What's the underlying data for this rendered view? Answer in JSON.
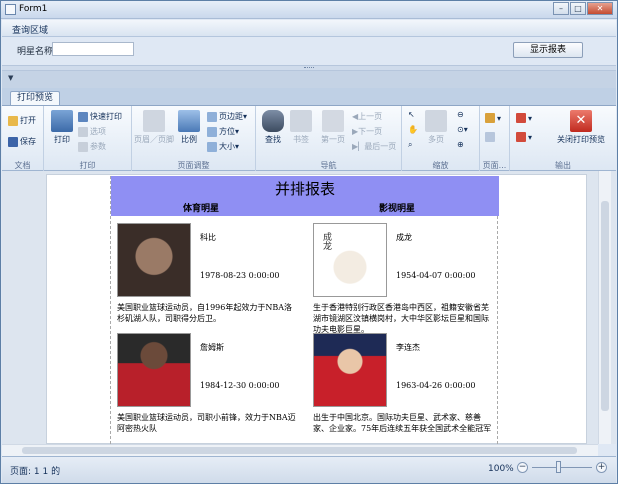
{
  "window": {
    "title": "Form1",
    "min_icon": "minimize-icon",
    "max_icon": "maximize-icon",
    "close_icon": "close-icon"
  },
  "query": {
    "header": "查询区域",
    "star_label": "明星名称",
    "star_value": "",
    "show_button": "显示报表"
  },
  "qat_icon": "dropdown-icon",
  "tab": {
    "label": "打印预览"
  },
  "ribbon": {
    "doc": {
      "label": "文档",
      "open": "打开",
      "save": "保存"
    },
    "print": {
      "label": "打印",
      "print": "打印",
      "quick_print": "快速打印",
      "options": "选项",
      "params": "参数"
    },
    "page_setup": {
      "label": "页面调整",
      "header_footer": "页眉／页脚",
      "scale": "比例",
      "margins": "页边距",
      "orientation": "方位",
      "size": "大小"
    },
    "nav": {
      "label": "导航",
      "find": "查找",
      "bookmarks": "书签",
      "first": "第一页",
      "prev": "上一页",
      "next": "下一页",
      "last": "最后一页"
    },
    "zoom": {
      "label": "缩放",
      "many_pages": "多页"
    },
    "page_bg": {
      "label": "页面..."
    },
    "export": {
      "label": "输出",
      "close": "关闭打印预览"
    }
  },
  "report": {
    "title": "并排报表",
    "col_left": "体育明星",
    "col_right": "影视明星",
    "left": [
      {
        "name": "科比",
        "date": "1978-08-23 0:00:00",
        "desc": "美国职业篮球运动员，自1996年起效力于NBA洛杉矶湖人队，司职得分后卫。"
      },
      {
        "name": "詹姆斯",
        "date": "1984-12-30 0:00:00",
        "desc": "美国职业篮球运动员，司职小前锋，效力于NBA迈阿密热火队"
      }
    ],
    "right": [
      {
        "name": "成龙",
        "date": "1954-04-07 0:00:00",
        "desc": "生于香港特别行政区香港岛中西区，祖籍安徽省芜湖市镜湖区汶镇横岗村，大中华区影坛巨星和国际功夫电影巨星。"
      },
      {
        "name": "李连杰",
        "date": "1963-04-26 0:00:00",
        "desc": "出生于中国北京。国际功夫巨星、武术家、慈善家、企业家。75年后连续五年获全国武术全能冠军"
      }
    ],
    "photo_text_jc": "成龙"
  },
  "status": {
    "page": "页面: 1 1 的",
    "zoom": "100%"
  }
}
